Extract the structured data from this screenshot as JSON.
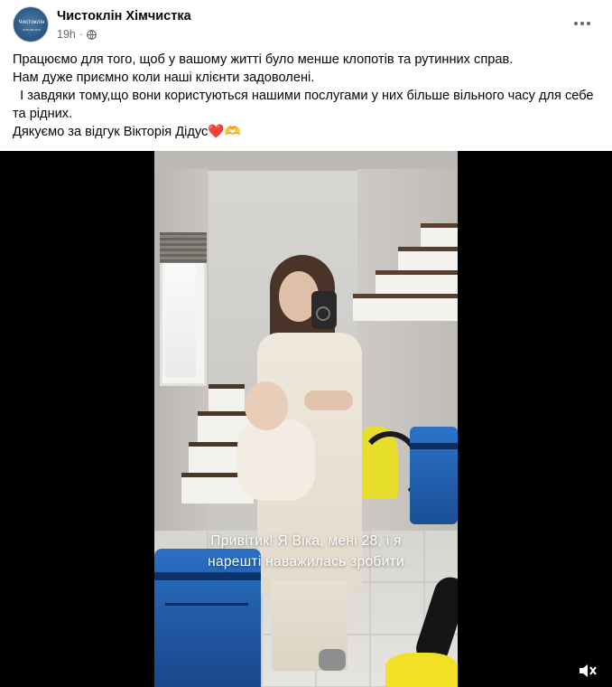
{
  "post": {
    "page_name": "Чистоклін Хімчистка",
    "avatar_text": "Чистоклін",
    "avatar_subtext": "хімчистка",
    "time": "19h",
    "separator": "·",
    "audience_icon": "globe-icon",
    "more_icon": "more-horizontal-icon"
  },
  "text": {
    "line1": "Працюємо для того, щоб у вашому житті було менше клопотів та рутинних справ.",
    "line2": "Нам дуже приємно коли наші клієнти задоволені.",
    "line3": "  І завдяки тому,що вони користуються нашими послугами у них більше вільного часу для себе та рідних.",
    "line4": "Дякуємо за відгук Вікторія Дідус",
    "emoji_heart": "❤️",
    "emoji_hands": "🫶"
  },
  "video": {
    "caption_line1": "Привітик! Я Віка, мені 28, і я",
    "caption_line2": "нарешті наважилась зробити",
    "volume_icon": "volume-muted-icon"
  },
  "colors": {
    "text": "#050505",
    "meta": "#65676b",
    "video_bg": "#000000",
    "bag_blue": "#1f5fb0",
    "vacuum_yellow": "#f1e024"
  }
}
